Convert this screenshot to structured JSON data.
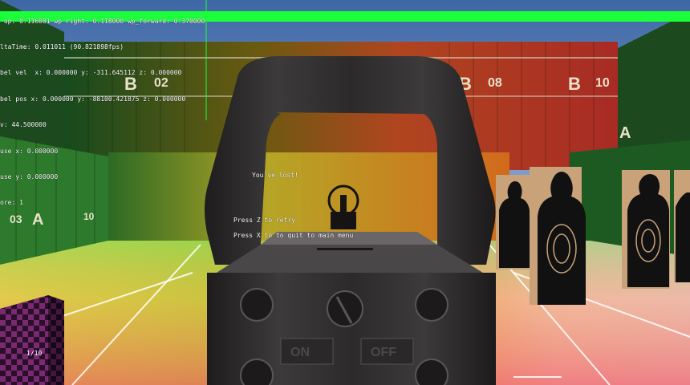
{
  "debug": {
    "lines": [
      " up: 0.116001 wp right: 0.118000 wp_forward: 0.370000",
      "ltaTime: 0.011011 (90.821898fps)",
      "bel vel  x: 0.000000 y: -311.645112 z: 0.000000",
      "bel pos x: 0.000000 y: -88100.421875 z: 0.000000",
      "v: 44.500000",
      "use x: 0.000000",
      "use y: 0.000000",
      "ore: 1"
    ]
  },
  "game_over": {
    "title": "You've lost!",
    "retry": "Press Z to retry",
    "quit": "Press X to to quit to main menu"
  },
  "hud": {
    "ammo_counter": "1/10",
    "health_bar_color": "#1aff3a"
  },
  "scope": {
    "on_label": "ON",
    "off_label": "OFF"
  },
  "container_markings": {
    "b1": "B",
    "n1": "02",
    "b2": "B",
    "n2": "08",
    "b3": "B",
    "n3": "10",
    "a1": "A",
    "n4": "03",
    "n5": "10",
    "a2": "A"
  }
}
